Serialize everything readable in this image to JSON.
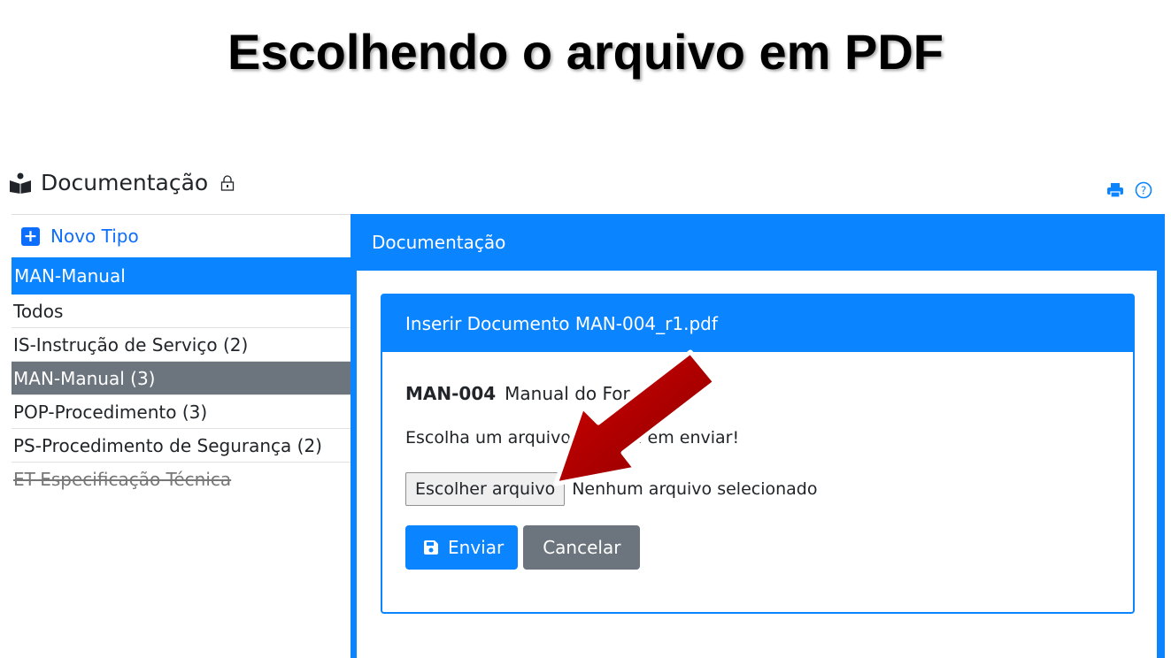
{
  "slide": {
    "title": "Escolhendo o arquivo em PDF"
  },
  "app": {
    "title": "Documentação"
  },
  "icons": {
    "book": "reading-book-icon",
    "lock": "lock-icon",
    "print": "print-icon",
    "help": "help-circle-icon",
    "plus": "plus-square-icon",
    "save": "floppy-disk-icon",
    "annotation": "red-arrow"
  },
  "colors": {
    "primary": "#0a84ff",
    "secondary": "#6c757d",
    "arrow": "#b30000"
  },
  "sidebar": {
    "new_type_label": "Novo Tipo",
    "selected_label": "MAN-Manual",
    "items": [
      {
        "label": "Todos"
      },
      {
        "label": "IS-Instrução de Serviço (2)"
      },
      {
        "label": "MAN-Manual (3)"
      },
      {
        "label": "POP-Procedimento (3)"
      },
      {
        "label": "PS-Procedimento de Segurança (2)"
      },
      {
        "label": "ET-Especificação Técnica"
      }
    ]
  },
  "main": {
    "header": "Documentação",
    "card": {
      "title": "Inserir Documento MAN-004_r1.pdf",
      "doc_code": "MAN-004",
      "doc_name": "Manual do For",
      "instruction": "Escolha um arquivo e clique em enviar!",
      "file_button": "Escolher arquivo",
      "file_status": "Nenhum arquivo selecionado",
      "submit_label": "Enviar",
      "cancel_label": "Cancelar"
    }
  }
}
